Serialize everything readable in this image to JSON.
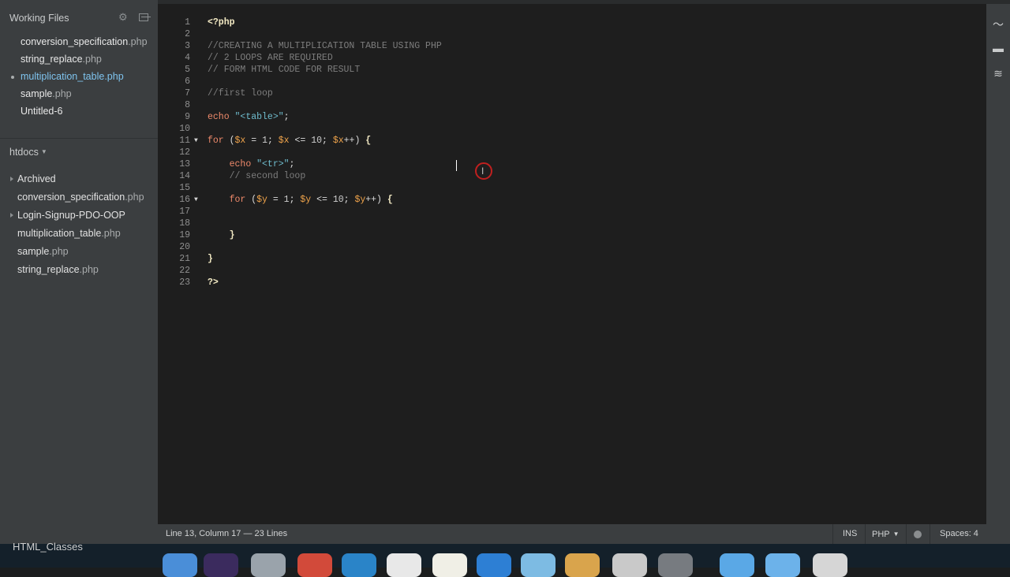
{
  "sidebar": {
    "working_files_header": "Working Files",
    "working_files": [
      {
        "name": "conversion_specification",
        "ext": ".php",
        "active": false
      },
      {
        "name": "string_replace",
        "ext": ".php",
        "active": false
      },
      {
        "name": "multiplication_table",
        "ext": ".php",
        "active": true
      },
      {
        "name": "sample",
        "ext": ".php",
        "active": false
      },
      {
        "name": "Untitled-6",
        "ext": "",
        "active": false
      }
    ],
    "project_header": "htdocs",
    "tree": [
      {
        "name": "Archived",
        "ext": "",
        "folder": true
      },
      {
        "name": "conversion_specification",
        "ext": ".php",
        "folder": false
      },
      {
        "name": "Login-Signup-PDO-OOP",
        "ext": "",
        "folder": true
      },
      {
        "name": "multiplication_table",
        "ext": ".php",
        "folder": false
      },
      {
        "name": "sample",
        "ext": ".php",
        "folder": false
      },
      {
        "name": "string_replace",
        "ext": ".php",
        "folder": false
      }
    ]
  },
  "editor": {
    "lines": [
      "1",
      "2",
      "3",
      "4",
      "5",
      "6",
      "7",
      "8",
      "9",
      "10",
      "11",
      "12",
      "13",
      "14",
      "15",
      "16",
      "17",
      "18",
      "19",
      "20",
      "21",
      "22",
      "23"
    ]
  },
  "status": {
    "position": "Line 13, Column 17",
    "line_count": "— 23 Lines",
    "mode": "INS",
    "language": "PHP",
    "spaces": "Spaces: 4"
  },
  "dock": {
    "label": "HTML_Classes",
    "icons": [
      "finder-icon",
      "eclipse-icon",
      "launchpad-icon",
      "chrome-icon",
      "brackets-icon",
      "calendar-icon",
      "notes-icon",
      "safari-icon",
      "facetime-icon",
      "preview-icon",
      "disk-utility-icon",
      "system-preferences-icon",
      "folder-icon",
      "folder-icon",
      "trash-icon"
    ]
  },
  "colors": {
    "sidebar_bg": "#3b3e40",
    "editor_bg": "#1e1e1e",
    "active_file": "#7fc4ef",
    "keyword": "#ef8a6b",
    "variable": "#f0a44b",
    "string": "#6fbccd",
    "comment": "#7d7d7d"
  }
}
